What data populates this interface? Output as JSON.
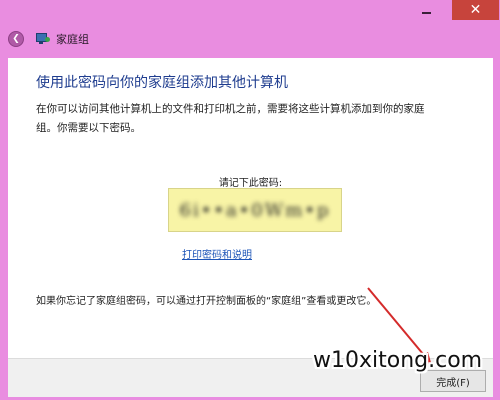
{
  "window": {
    "title": "家庭组",
    "minimize_glyph": "",
    "close_glyph": "✕"
  },
  "nav": {
    "back_glyph": "❮",
    "title": "家庭组",
    "icon": "homegroup-icon"
  },
  "panel": {
    "heading": "使用此密码向你的家庭组添加其他计算机",
    "description": "在你可以访问其他计算机上的文件和打印机之前，需要将这些计算机添加到你的家庭组。你需要以下密码。",
    "password_label": "请记下此密码:",
    "password_value": "6i••a•0Wm•p",
    "print_link": "打印密码和说明",
    "footer_note": "如果你忘记了家庭组密码，可以通过打开控制面板的“家庭组”查看或更改它。"
  },
  "actions": {
    "finish_label": "完成(F)"
  },
  "annotation": {
    "arrow_color": "#d42b2b"
  },
  "watermark": {
    "text": "w10xitong.com"
  },
  "colors": {
    "window_bg": "#e98de0",
    "heading": "#1f3d8f",
    "link": "#1d55b8",
    "password_bg": "#f8f4a6",
    "close_bg": "#c7443c"
  }
}
